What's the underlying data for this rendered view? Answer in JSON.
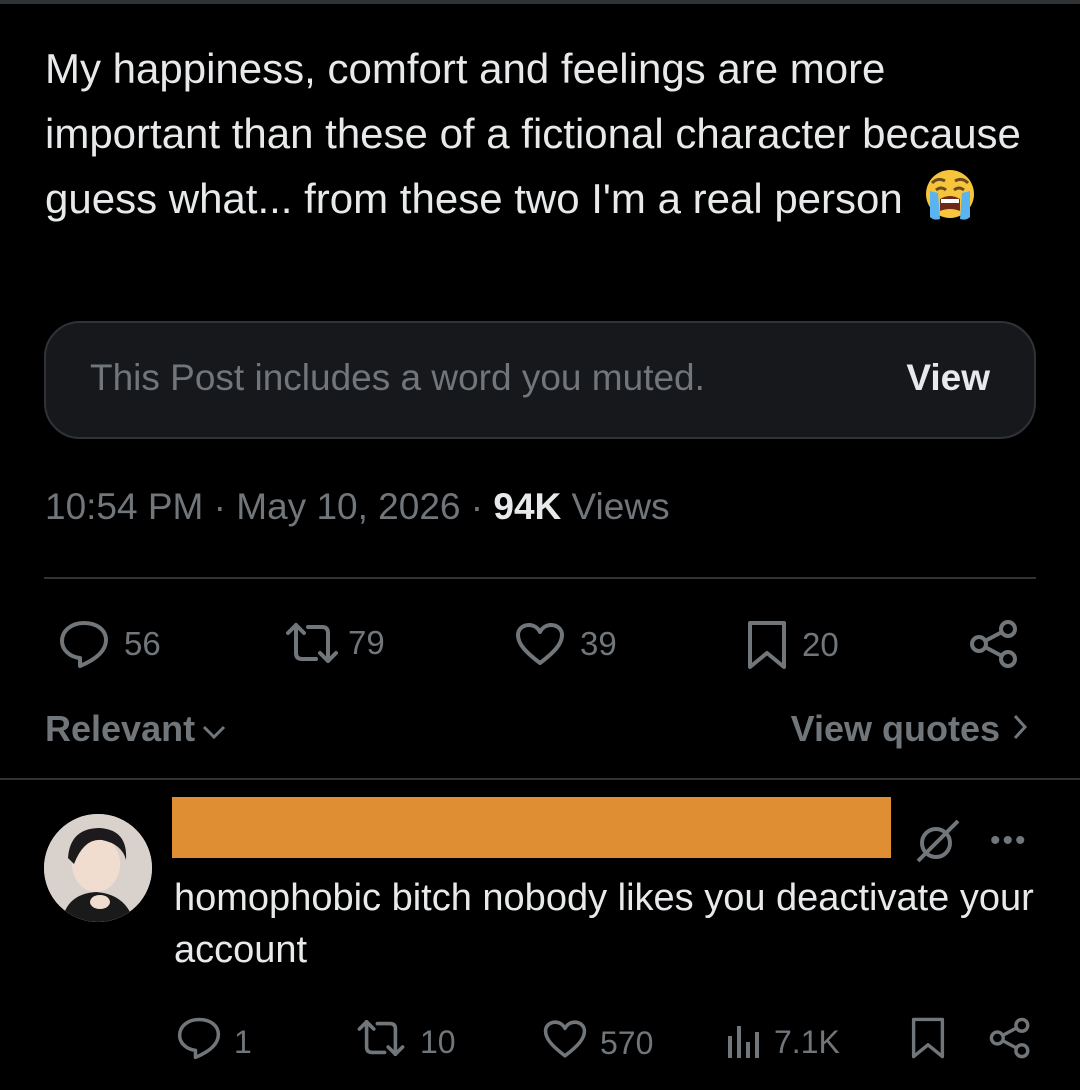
{
  "post": {
    "text": "My happiness, comfort and feelings are more important than these of a fictional character because guess what... from these two I'm a real person",
    "emoji": "loudly-crying-face",
    "muted_notice": "This Post includes a word you muted.",
    "muted_view_label": "View",
    "time": "10:54 PM",
    "date": "May 10, 2026",
    "views_count": "94K",
    "views_label": "Views",
    "separator": "·",
    "actions": {
      "replies": "56",
      "reposts": "79",
      "likes": "39",
      "bookmarks": "20"
    }
  },
  "sort": {
    "relevant_label": "Relevant",
    "view_quotes_label": "View quotes"
  },
  "reply": {
    "username_redacted": true,
    "text": "homophobic bitch nobody likes you deactivate your account",
    "actions": {
      "replies": "1",
      "reposts": "10",
      "likes": "570",
      "views": "7.1K"
    }
  },
  "colors": {
    "background": "#000000",
    "text_primary": "#e7e9ea",
    "text_secondary": "#71767b",
    "divider": "#2f3336",
    "redaction": "#e08e34"
  }
}
